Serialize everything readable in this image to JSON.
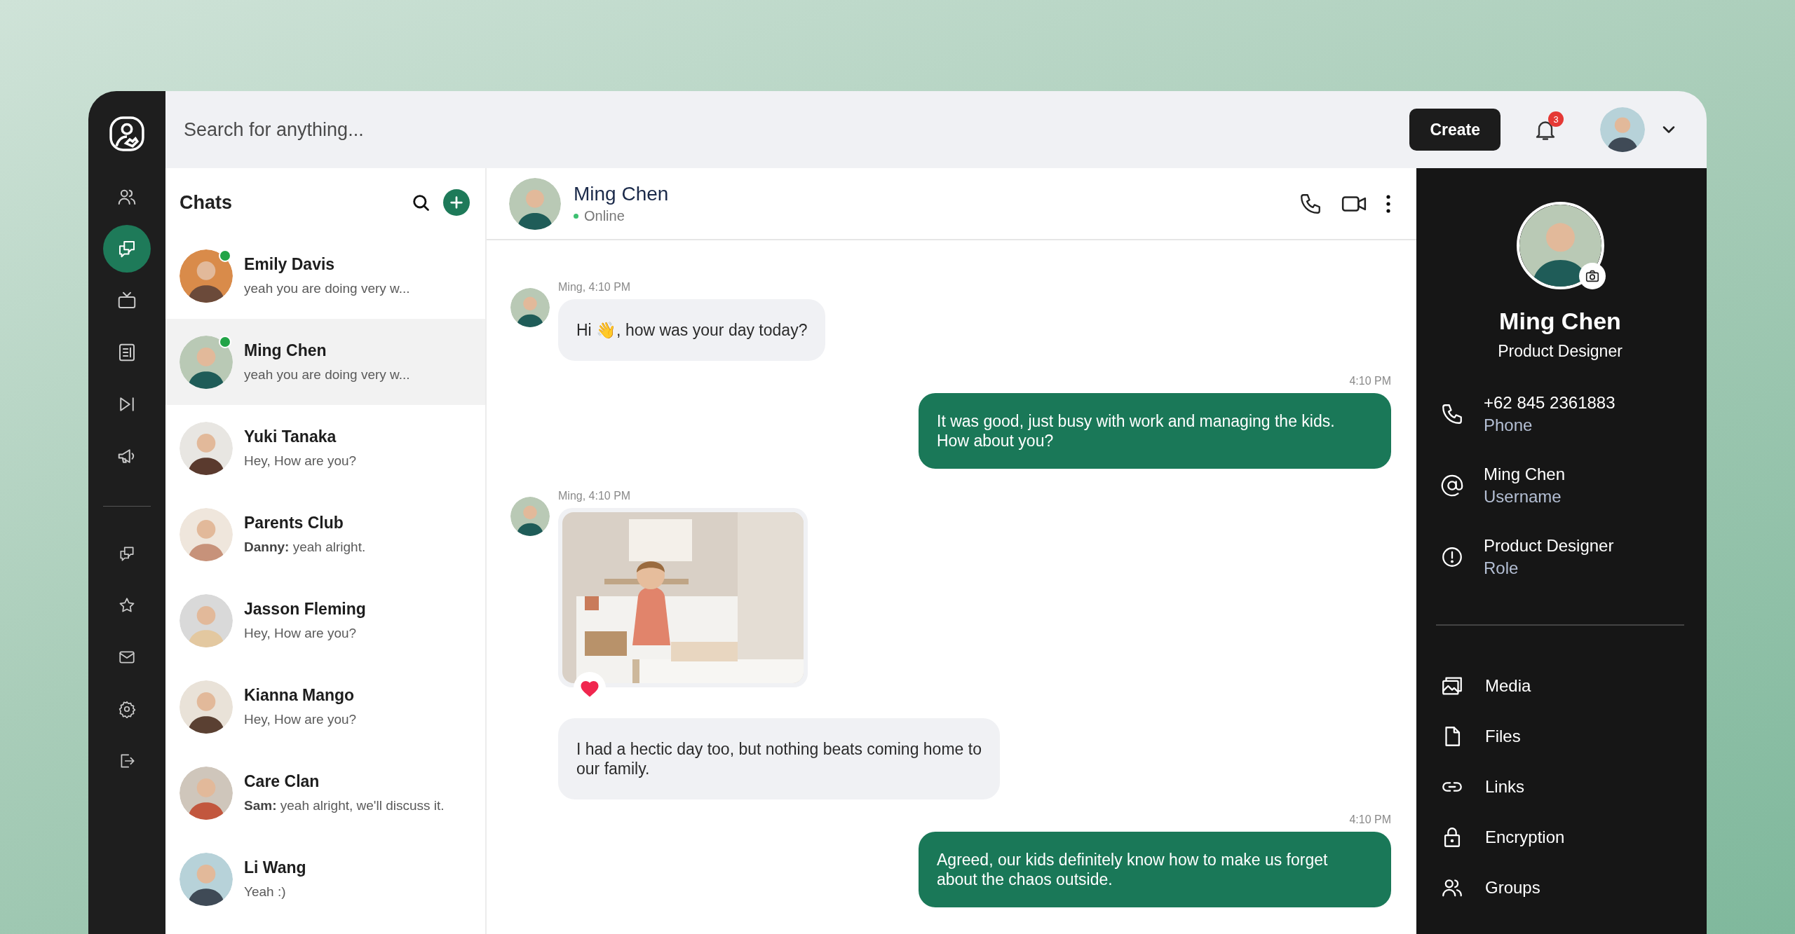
{
  "rail": {
    "top": [
      {
        "selected": false
      },
      {
        "selected": true
      },
      {
        "selected": false
      },
      {
        "selected": false
      },
      {
        "selected": false
      },
      {
        "selected": false
      }
    ],
    "bottom": [
      {
        "selected": false
      },
      {
        "selected": false
      },
      {
        "selected": false
      },
      {
        "selected": false
      },
      {
        "selected": false
      }
    ]
  },
  "topbar": {
    "search": {
      "placeholder": "Search for anything..."
    },
    "create_button": "Create",
    "notifications": "3"
  },
  "chats": {
    "title": "Chats",
    "items": [
      {
        "name": "Emily Davis",
        "preview": "yeah you are doing very w...",
        "online": true,
        "selected": false
      },
      {
        "name": "Ming Chen",
        "preview": "yeah you are doing very w...",
        "online": true,
        "selected": true
      },
      {
        "name": "Yuki Tanaka",
        "preview": "Hey, How are you?",
        "online": false,
        "selected": false
      },
      {
        "name": "Parents Club",
        "preview": "**Danny:** yeah alright.",
        "online": false,
        "selected": false
      },
      {
        "name": "Jasson Fleming",
        "preview": "Hey, How are you?",
        "online": false,
        "selected": false
      },
      {
        "name": "Kianna Mango",
        "preview": "Hey, How are you?",
        "online": false,
        "selected": false
      },
      {
        "name": "Care Clan",
        "preview": "**Sam:** yeah alright, we'll discuss it.",
        "online": false,
        "selected": false
      },
      {
        "name": "Li Wang",
        "preview": "Yeah :)",
        "online": false,
        "selected": false
      }
    ]
  },
  "conversation": {
    "name": "Ming Chen",
    "status": "Online",
    "messages": [
      {
        "kind": "received",
        "meta": "Ming, 4:10 PM",
        "text": "Hi 👋, how was your day today?"
      },
      {
        "kind": "sent",
        "meta": "4:10 PM",
        "text": "It was good, just busy with work and managing the kids.\nHow about you?"
      },
      {
        "meta": "Ming, 4:10 PM",
        "reacted": true
      },
      {
        "kind": "received",
        "text": "I had a hectic day too, but nothing beats coming home to\nour family."
      },
      {
        "kind": "sent",
        "meta": "4:10 PM",
        "text": "Agreed, our kids definitely know how to make us forget\nabout the chaos outside."
      }
    ]
  },
  "profile": {
    "name": "Ming Chen",
    "role": "Product Designer",
    "details": [
      {
        "value": "+62 845 2361883",
        "label": "Phone"
      },
      {
        "value": "Ming Chen",
        "label": "Username"
      },
      {
        "value": "Product Designer",
        "label": "Role"
      }
    ],
    "links": [
      "Media",
      "Files",
      "Links",
      "Encryption",
      "Groups"
    ]
  }
}
